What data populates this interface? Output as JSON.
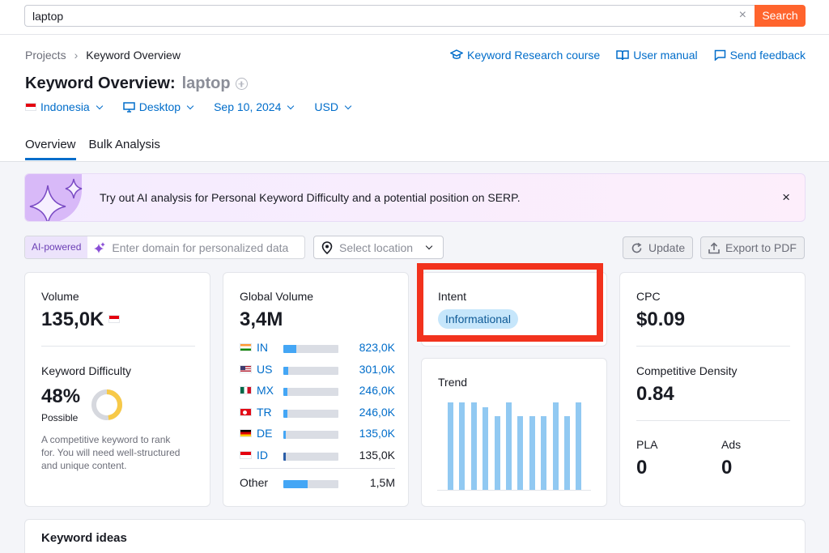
{
  "search": {
    "value": "laptop",
    "clear_glyph": "×",
    "button_label": "Search"
  },
  "breadcrumb": {
    "root": "Projects",
    "separator": "›",
    "current": "Keyword Overview"
  },
  "top_links": [
    {
      "label": "Keyword Research course",
      "icon": "graduation-cap-icon"
    },
    {
      "label": "User manual",
      "icon": "book-icon"
    },
    {
      "label": "Send feedback",
      "icon": "feedback-icon"
    }
  ],
  "title": {
    "prefix": "Keyword Overview:",
    "keyword": "laptop"
  },
  "filters": {
    "country": "Indonesia",
    "device": "Desktop",
    "date": "Sep 10, 2024",
    "currency": "USD"
  },
  "tabs": [
    {
      "label": "Overview",
      "active": true
    },
    {
      "label": "Bulk Analysis",
      "active": false
    }
  ],
  "banner": {
    "pre": "Try out ",
    "bold": "AI analysis",
    "post": " for Personal Keyword Difficulty and a potential position on SERP.",
    "close": "×"
  },
  "tools": {
    "ai_badge": "AI-powered",
    "domain_placeholder": "Enter domain for personalized data",
    "location_placeholder": "Select location",
    "update_label": "Update",
    "export_label": "Export to PDF"
  },
  "volume": {
    "label": "Volume",
    "value": "135,0K"
  },
  "difficulty": {
    "label": "Keyword Difficulty",
    "value": "48%",
    "percent": 48,
    "rating": "Possible",
    "desc_lines": [
      "A competitive keyword to rank",
      "for. You will need well-structured",
      "and unique content."
    ],
    "color": "#f7c948"
  },
  "global_volume": {
    "label": "Global Volume",
    "value": "3,4M",
    "rows": [
      {
        "code": "IN",
        "value": "823,0K",
        "share": 0.24,
        "flag": "in"
      },
      {
        "code": "US",
        "value": "301,0K",
        "share": 0.09,
        "flag": "us"
      },
      {
        "code": "MX",
        "value": "246,0K",
        "share": 0.07,
        "flag": "mx"
      },
      {
        "code": "TR",
        "value": "246,0K",
        "share": 0.07,
        "flag": "tr"
      },
      {
        "code": "DE",
        "value": "135,0K",
        "share": 0.04,
        "flag": "de"
      },
      {
        "code": "ID",
        "value": "135,0K",
        "share": 0.04,
        "flag": "id"
      }
    ],
    "other": {
      "code": "Other",
      "value": "1,5M",
      "share": 0.44
    }
  },
  "intent": {
    "label": "Intent",
    "value": "Informational"
  },
  "trend": {
    "label": "Trend",
    "values": [
      1.0,
      1.0,
      1.0,
      0.94,
      0.84,
      1.0,
      0.84,
      0.84,
      0.84,
      1.0,
      0.84,
      1.0
    ]
  },
  "cpc": {
    "label": "CPC",
    "value": "$0.09"
  },
  "competitive_density": {
    "label": "Competitive Density",
    "value": "0.84"
  },
  "pla": {
    "label": "PLA",
    "value": "0"
  },
  "ads": {
    "label": "Ads",
    "value": "0"
  },
  "keyword_ideas": {
    "label": "Keyword ideas"
  },
  "colors": {
    "accent": "#006dca",
    "search_button": "#ff642d",
    "highlight": "#f2321d",
    "bar": "#44a6f5"
  }
}
